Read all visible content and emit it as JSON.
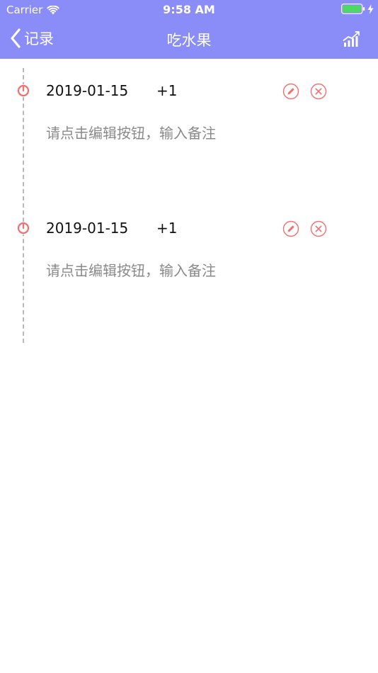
{
  "status_bar": {
    "carrier": "Carrier",
    "time": "9:58 AM"
  },
  "nav": {
    "back_label": "记录",
    "title": "吃水果"
  },
  "records": [
    {
      "date": "2019-01-15",
      "count": "+1",
      "note": "请点击编辑按钮，输入备注"
    },
    {
      "date": "2019-01-15",
      "count": "+1",
      "note": "请点击编辑按钮，输入备注"
    }
  ],
  "colors": {
    "header": "#8a8cf7",
    "accent": "#f26f6f",
    "note_text": "#8a8a8a",
    "battery": "#4cd964"
  }
}
